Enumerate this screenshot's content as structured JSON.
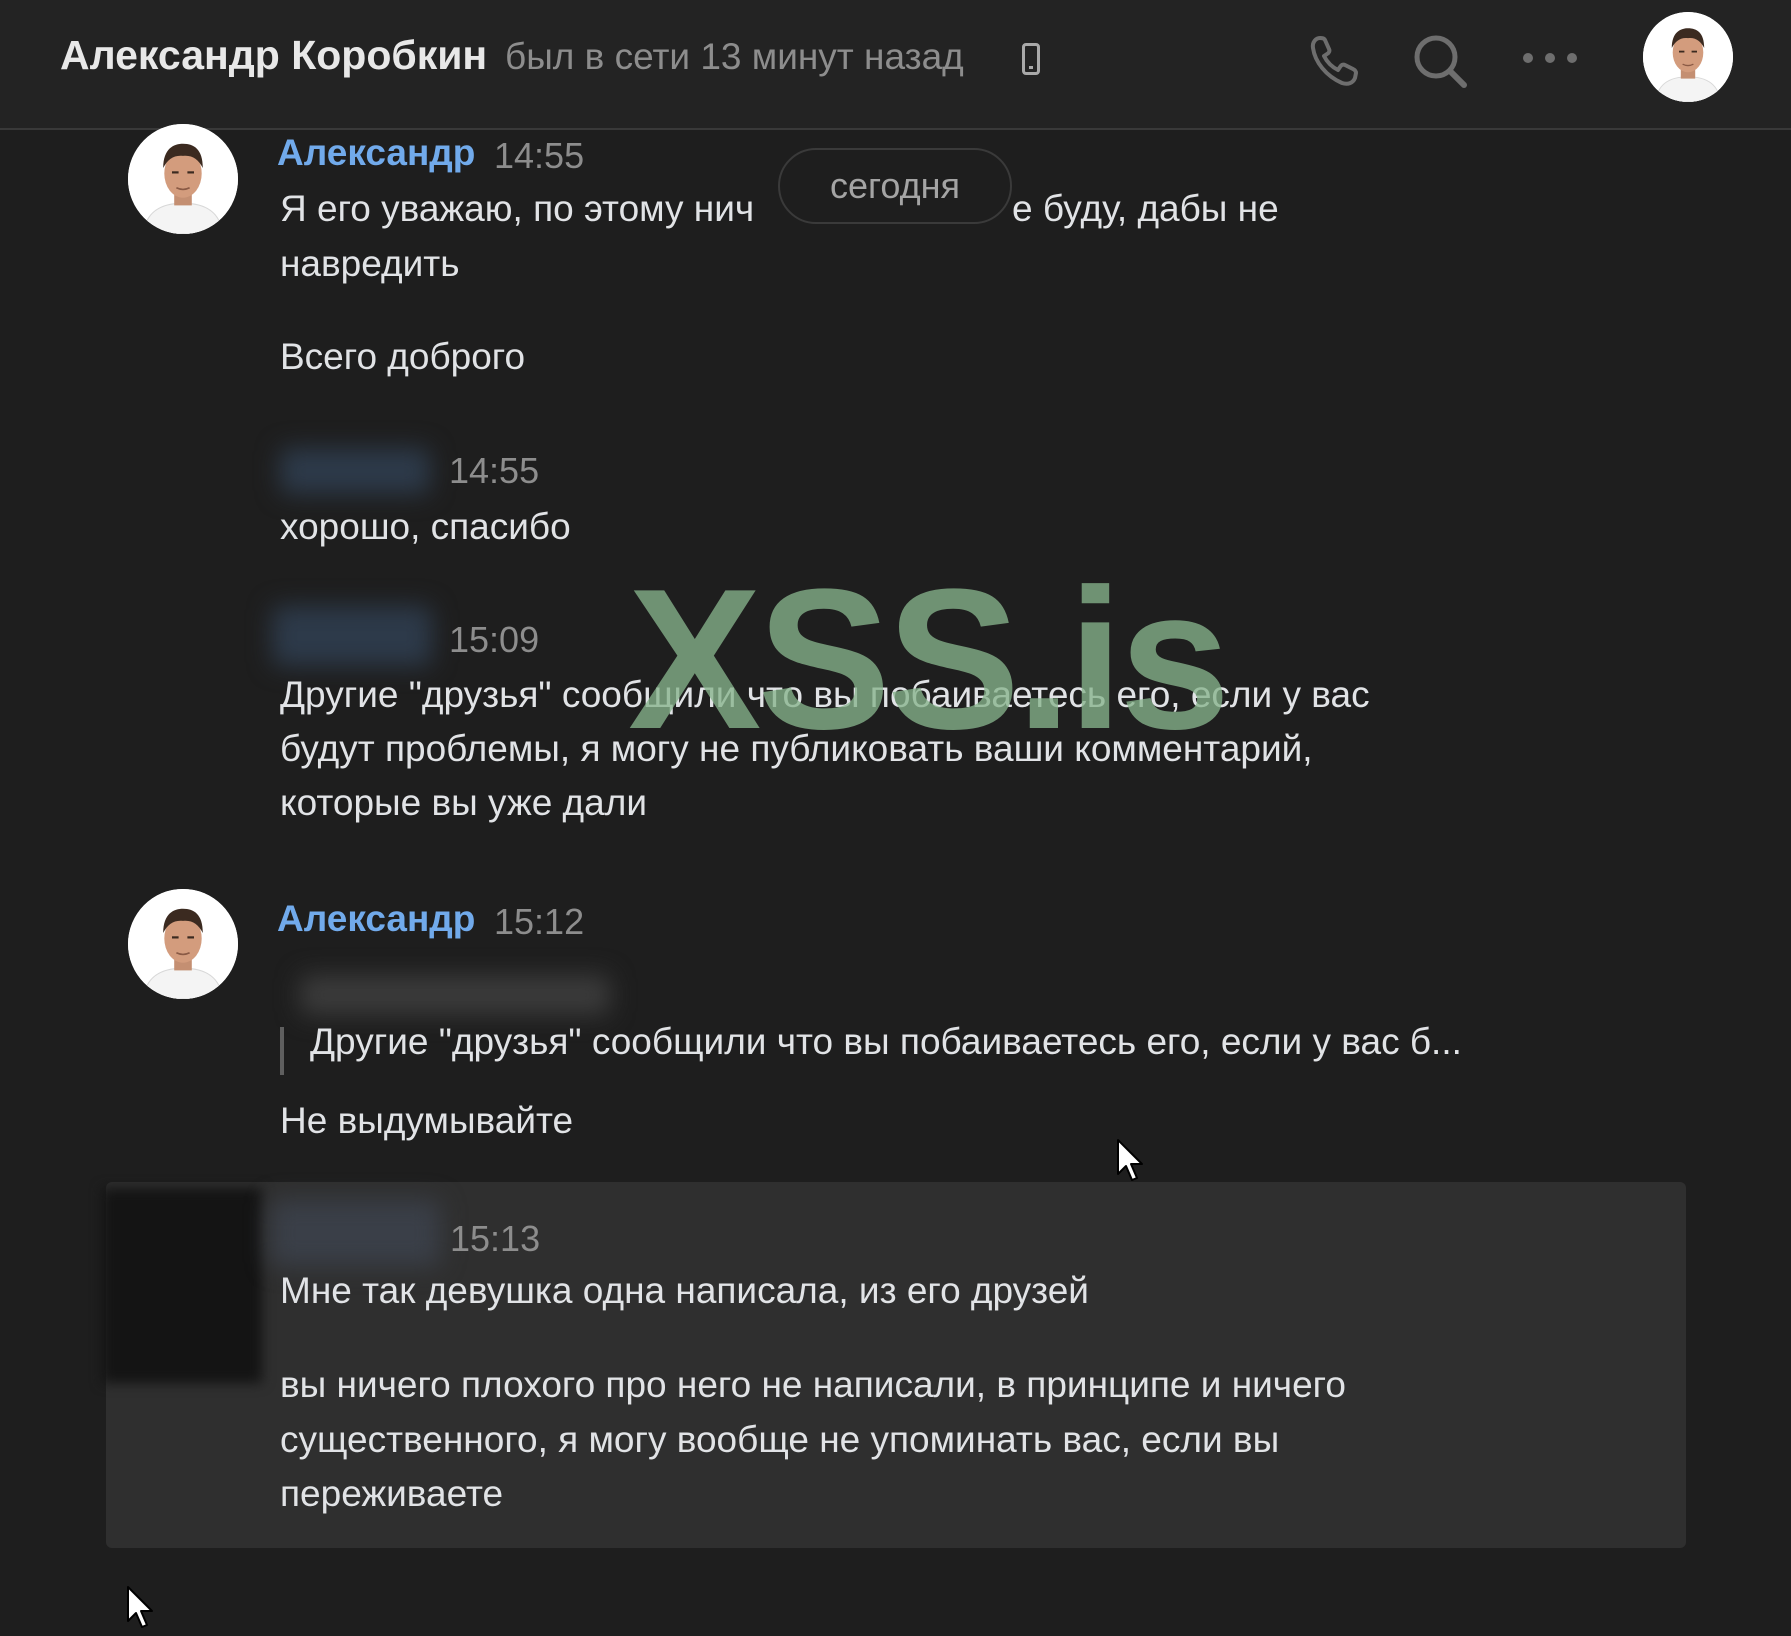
{
  "header": {
    "name": "Александр Коробкин",
    "status": "был в сети 13 минут назад"
  },
  "date_divider": "сегодня",
  "watermark": "XSS.is",
  "messages": [
    {
      "author": "Александр",
      "time": "14:55",
      "lines": [
        "Я его уважаю, по этому нич",
        "е буду, дабы не",
        "навредить",
        "Всего доброго"
      ]
    },
    {
      "author": "",
      "time": "14:55",
      "lines": [
        "хорошо, спасибо"
      ]
    },
    {
      "author": "",
      "time": "15:09",
      "lines": [
        "Другие \"друзья\" сообщили что вы побаиваетесь его, если у вас",
        "будут проблемы, я могу не публиковать ваши комментарий,",
        "которые вы уже дали"
      ]
    },
    {
      "author": "Александр",
      "time": "15:12",
      "quote": "Другие \"друзья\" сообщили что вы побаиваетесь его, если у вас б...",
      "lines": [
        "Не выдумывайте"
      ]
    },
    {
      "author": "",
      "time": "15:13",
      "lines": [
        "Мне так девушка одна написала, из его друзей",
        "вы ничего плохого про него не написали, в принципе и ничего",
        "существенного, я могу вообще не упоминать вас, если вы",
        "переживаете"
      ]
    }
  ],
  "colors": {
    "background": "#1e1e1e",
    "author": "#71aaeb",
    "muted": "#8d8d8d",
    "highlight_row": "#2f2f2f",
    "watermark": "#87b48c"
  },
  "icons": [
    "phone-icon",
    "search-icon",
    "more-icon",
    "mobile-device-icon",
    "cursor-icon"
  ]
}
